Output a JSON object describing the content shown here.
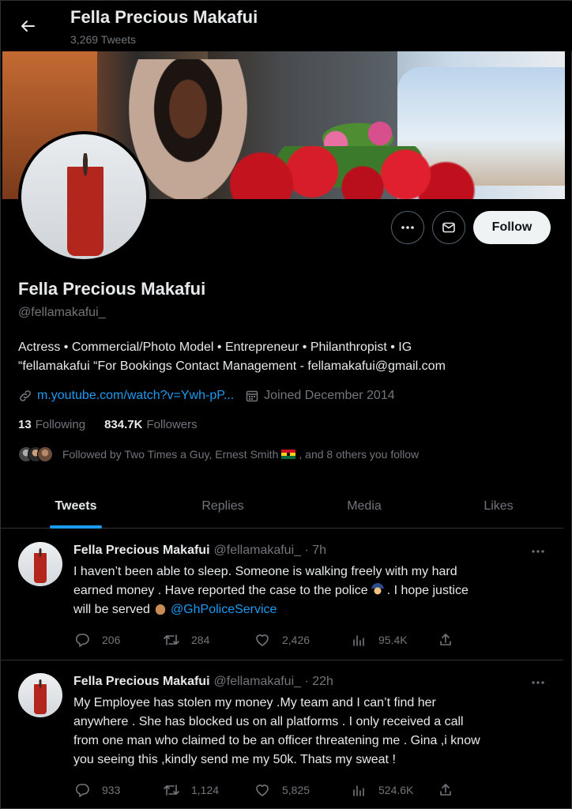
{
  "header": {
    "name": "Fella Precious Makafui",
    "tweet_count": "3,269 Tweets"
  },
  "profile": {
    "display_name": "Fella Precious Makafui",
    "handle": "@fellamakafui_",
    "bio_line1": "Actress • Commercial/Photo Model • Entrepreneur • Philanthropist • IG",
    "bio_line2": "“fellamakafui “For Bookings Contact Management - fellamakafui@gmail.com",
    "link": "m.youtube.com/watch?v=Ywh-pP...",
    "joined": "Joined December 2014",
    "following_count": "13",
    "following_label": "Following",
    "followers_count": "834.7K",
    "followers_label": "Followers",
    "followed_by_prefix": "Followed by Two Times a Guy, Ernest Smith",
    "followed_by_suffix": ", and 8 others you follow",
    "follow_button": "Follow"
  },
  "tabs": [
    {
      "label": "Tweets",
      "active": true
    },
    {
      "label": "Replies",
      "active": false
    },
    {
      "label": "Media",
      "active": false
    },
    {
      "label": "Likes",
      "active": false
    }
  ],
  "tweets": [
    {
      "name": "Fella Precious Makafui",
      "handle_time": "@fellamakafui_ · 7h",
      "text_line1": "I haven’t been able to sleep. Someone is walking freely with my hard",
      "text_line2a": "earned money . Have reported the case to the police",
      "text_line2b": ". I hope justice",
      "text_line3a": "will be served",
      "mention": "@GhPoliceService",
      "replies": "206",
      "retweets": "284",
      "likes": "2,426",
      "views": "95.4K"
    },
    {
      "name": "Fella Precious Makafui",
      "handle_time": "@fellamakafui_ · 22h",
      "text_line1": "My Employee has stolen my money .My team and I can’t find her",
      "text_line2": "anywhere . She has blocked us on all platforms . I only received a call",
      "text_line3": "from one man who claimed to be an officer threatening me . Gina ,i know",
      "text_line4": "you seeing this ,kindly send me my 50k. Thats my sweat !",
      "replies": "933",
      "retweets": "1,124",
      "likes": "5,825",
      "views": "524.6K"
    }
  ],
  "colors": {
    "accent": "#1d9bf0",
    "background": "#000000",
    "text": "#e7e9ea",
    "muted": "#71767b",
    "border": "#2f3336"
  },
  "icons": [
    "back-arrow-icon",
    "more-icon",
    "mail-icon",
    "link-icon",
    "calendar-icon",
    "reply-icon",
    "retweet-icon",
    "like-icon",
    "views-icon",
    "share-icon"
  ]
}
